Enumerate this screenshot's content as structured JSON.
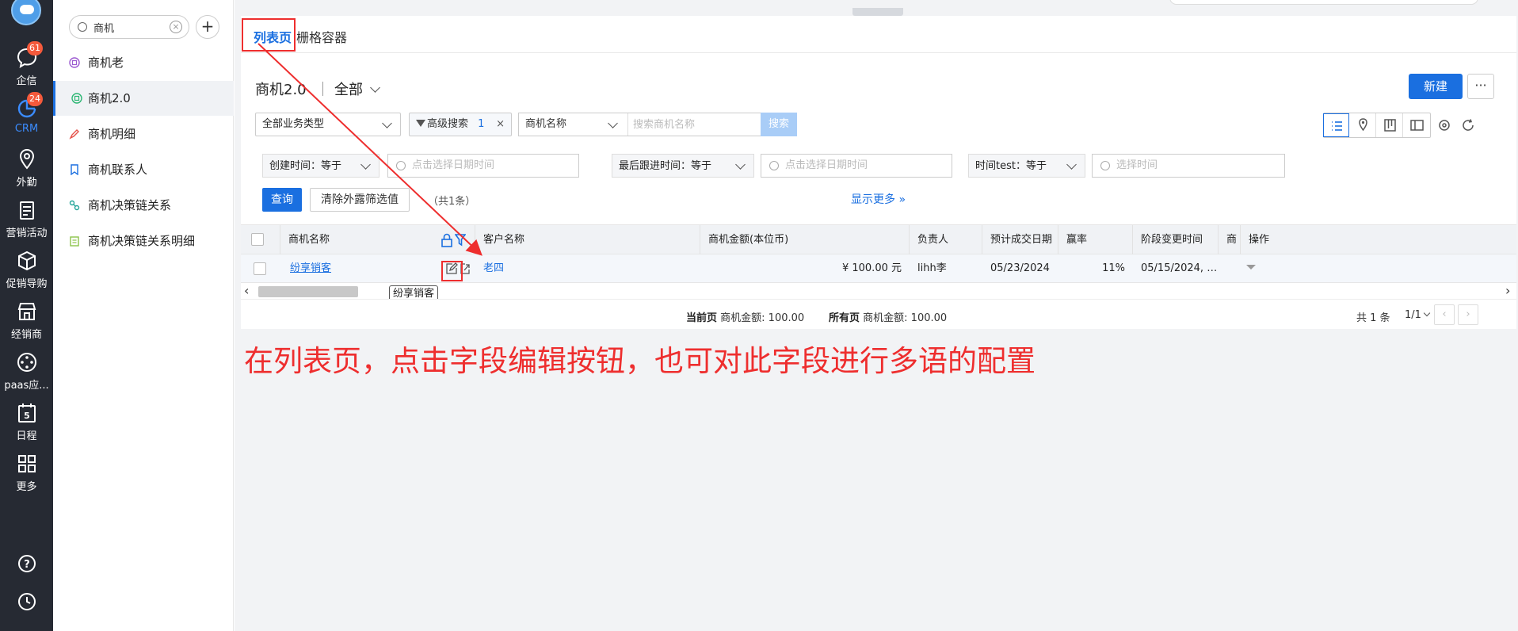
{
  "rail": {
    "items": [
      {
        "label": "企信",
        "icon": "chat-icon",
        "badge": "61"
      },
      {
        "label": "CRM",
        "icon": "crm-icon",
        "badge": "24",
        "active": true
      },
      {
        "label": "外勤",
        "icon": "location-icon"
      },
      {
        "label": "营销活动",
        "icon": "marketing-icon"
      },
      {
        "label": "促销导购",
        "icon": "box-icon"
      },
      {
        "label": "经销商",
        "icon": "store-icon"
      },
      {
        "label": "paas应...",
        "icon": "paas-icon"
      },
      {
        "label": "日程",
        "icon": "calendar-icon",
        "day": "5"
      },
      {
        "label": "更多",
        "icon": "grid-icon"
      }
    ]
  },
  "sidebar": {
    "search_value": "商机",
    "items": [
      {
        "label": "商机老",
        "icon": "object-icon",
        "color": "#9b59d0"
      },
      {
        "label": "商机2.0",
        "icon": "object-icon",
        "color": "#2bb673",
        "active": true
      },
      {
        "label": "商机明细",
        "icon": "detail-icon",
        "color": "#e5534b"
      },
      {
        "label": "商机联系人",
        "icon": "bookmark-icon",
        "color": "#1a6fe0"
      },
      {
        "label": "商机决策链关系",
        "icon": "link-icon",
        "color": "#26a69a"
      },
      {
        "label": "商机决策链关系明细",
        "icon": "clipboard-icon",
        "color": "#8bc34a"
      }
    ]
  },
  "tabs": [
    {
      "label": "列表页",
      "active": true
    },
    {
      "label": "栅格容器"
    }
  ],
  "header": {
    "title": "商机2.0",
    "scope": "全部",
    "new_button": "新建",
    "more_button": "···"
  },
  "filters": {
    "biz_type": "全部业务类型",
    "advanced_search": "高级搜索",
    "advanced_count": "1",
    "field_select": "商机名称",
    "search_placeholder": "搜索商机名称",
    "search_button": "搜索"
  },
  "conditions": [
    {
      "label": "创建时间：",
      "op": "等于",
      "placeholder": "点击选择日期时间"
    },
    {
      "label": "最后跟进时间：",
      "op": "等于",
      "placeholder": "点击选择日期时间"
    },
    {
      "label": "时间test：",
      "op": "等于",
      "placeholder": "选择时间"
    }
  ],
  "actions": {
    "query": "查询",
    "clear": "清除外露筛选值",
    "total": "（共1条）",
    "show_more": "显示更多"
  },
  "table": {
    "columns": [
      "商机名称",
      "客户名称",
      "商机金额(本位币)",
      "负责人",
      "预计成交日期",
      "赢率",
      "阶段变更时间",
      "商",
      "操作"
    ],
    "rows": [
      {
        "name": "纷享销客",
        "customer": "老四",
        "amount": "¥ 100.00 元",
        "owner": "lihh李",
        "close_date": "05/23/2024",
        "win_rate": "11%",
        "stage_time": "05/15/2024, 10..."
      }
    ]
  },
  "tooltip": "纷享销客",
  "footer": {
    "current_label": "当前页",
    "current_sum": "商机金额: 100.00",
    "all_label": "所有页",
    "all_sum": "商机金额: 100.00",
    "total": "共 1 条",
    "page": "1/1"
  },
  "annotation": "在列表页，点击字段编辑按钮，也可对此字段进行多语的配置",
  "colors": {
    "accent": "#1a6fe0",
    "rail_bg": "#262a33",
    "annotation": "#ee2e2e"
  }
}
